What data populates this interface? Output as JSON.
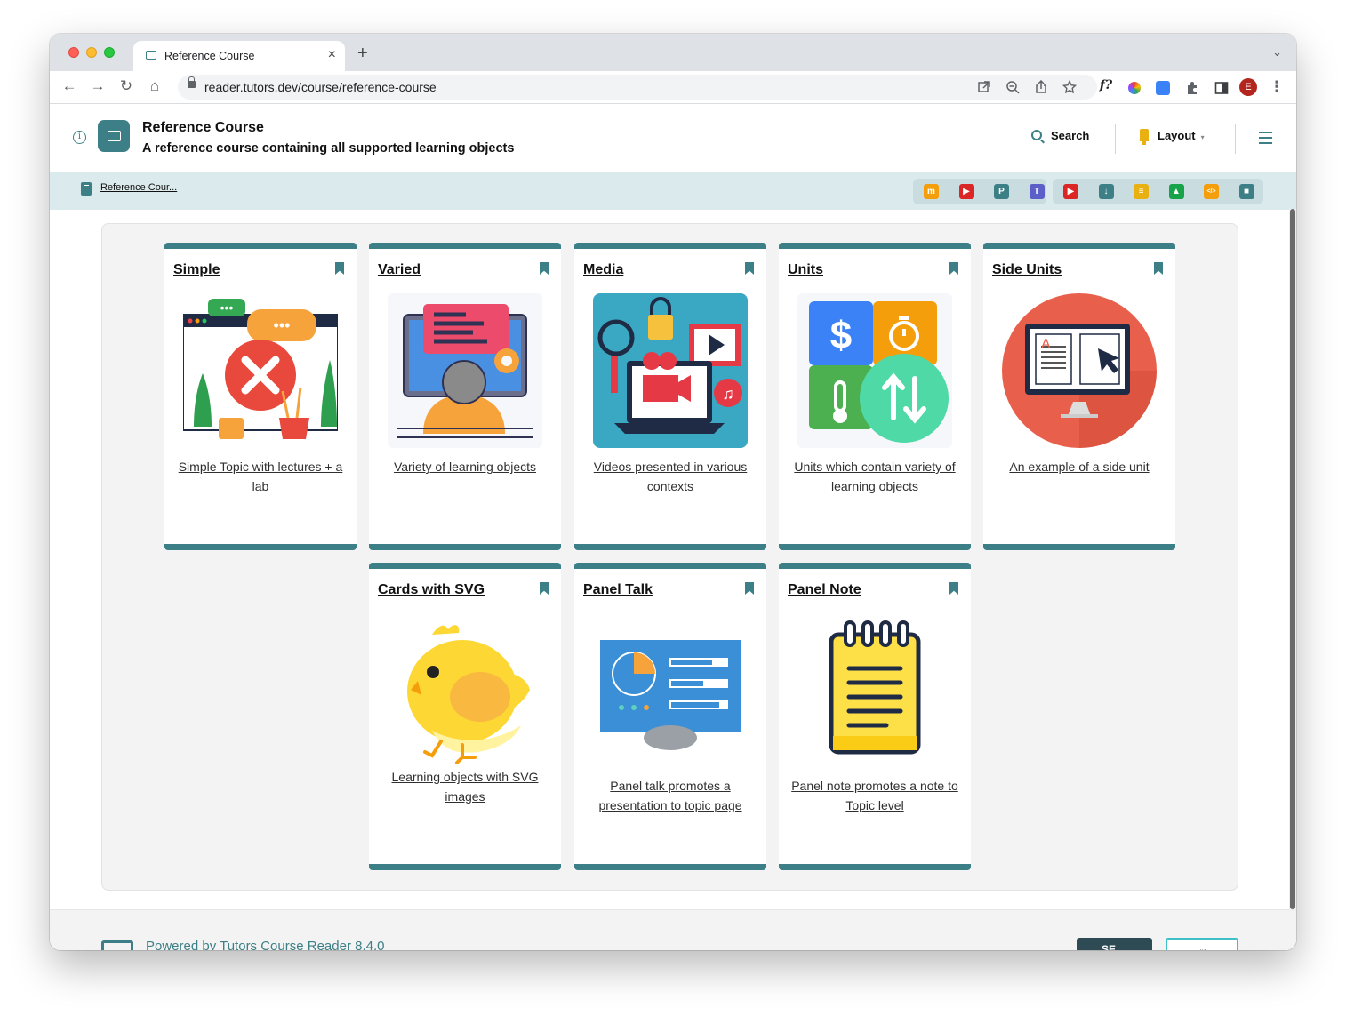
{
  "browser": {
    "tab_title": "Reference Course",
    "tab_close": "×",
    "new_tab": "+",
    "tab_menu": "⌄",
    "url": "reader.tutors.dev/course/reference-course",
    "nav": {
      "back": "←",
      "forward": "→",
      "reload": "↻",
      "home": "⌂"
    },
    "omnibox_icons": [
      "open-external",
      "zoom-out",
      "share",
      "star"
    ],
    "extension_f": "f?",
    "profile_initial": "E",
    "menu": "⋮"
  },
  "header": {
    "info": "i",
    "title": "Reference Course",
    "subtitle": "A reference course containing all supported learning objects",
    "search_label": "Search",
    "layout_label": "Layout",
    "layout_caret": "▾"
  },
  "breadcrumb": {
    "label": "Reference Cour..."
  },
  "toolbar_icons": {
    "group1": [
      {
        "name": "moodle-icon",
        "glyph": "m",
        "color": "#f59e0b"
      },
      {
        "name": "youtube-icon",
        "glyph": "▶",
        "color": "#dc2626"
      },
      {
        "name": "slack-icon",
        "glyph": "P",
        "color": "#3d7f86"
      },
      {
        "name": "teams-icon",
        "glyph": "T",
        "color": "#5b5fc7"
      }
    ],
    "group2": [
      {
        "name": "video-icon",
        "glyph": "▶",
        "color": "#dc2626"
      },
      {
        "name": "download-icon",
        "glyph": "↓",
        "color": "#3d7f86"
      },
      {
        "name": "notes-icon",
        "glyph": "≡",
        "color": "#e9b012"
      },
      {
        "name": "lab-icon",
        "glyph": "▲",
        "color": "#16a34a"
      },
      {
        "name": "code-icon",
        "glyph": "</>",
        "color": "#f59e0b"
      },
      {
        "name": "archive-icon",
        "glyph": "■",
        "color": "#3d7f86"
      }
    ]
  },
  "cards": [
    {
      "title": "Simple",
      "desc": "Simple Topic with lectures + a lab",
      "image": "error-window-illustration"
    },
    {
      "title": "Varied",
      "desc": "Variety of learning objects",
      "image": "computer-user-illustration"
    },
    {
      "title": "Media",
      "desc": "Videos presented in various contexts",
      "image": "media-laptop-illustration"
    },
    {
      "title": "Units",
      "desc": "Units which contain variety of learning objects",
      "image": "units-conversion-illustration"
    },
    {
      "title": "Side Units",
      "desc": "An example of a side unit",
      "image": "monitor-book-illustration"
    },
    {
      "title": "Cards with SVG",
      "desc": "Learning objects with SVG images",
      "image": "yellow-chick-illustration"
    },
    {
      "title": "Panel Talk",
      "desc": "Panel talk promotes a presentation to topic page",
      "image": "dashboard-screen-illustration"
    },
    {
      "title": "Panel Note",
      "desc": "Panel note promotes a note to Topic level",
      "image": "notepad-illustration"
    }
  ],
  "footer": {
    "text": "Powered by Tutors Course Reader 8.4.0",
    "badge_se": "SE",
    "badge_netlify": "netlify"
  },
  "colors": {
    "accent": "#3d7f86",
    "crumbbar": "#dbeaed",
    "panel": "#f3f3f3"
  }
}
